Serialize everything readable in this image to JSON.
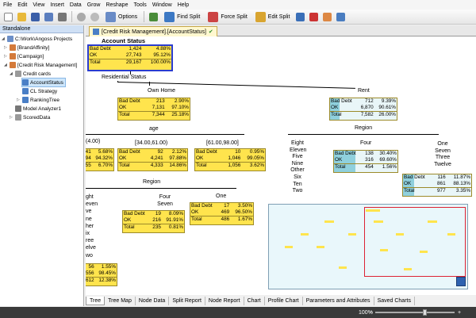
{
  "menu": [
    "File",
    "Edit",
    "View",
    "Insert",
    "Data",
    "Grow",
    "Reshape",
    "Tools",
    "Window",
    "Help"
  ],
  "toolbar": {
    "options": "Options",
    "find_split": "Find Split",
    "force_split": "Force Split",
    "edit_split": "Edit Split"
  },
  "left_panel": {
    "header": "Standalone",
    "items": [
      {
        "label": "C:\\Work\\Angoss Projects",
        "indent": 0
      },
      {
        "label": "[BrandAffinity]",
        "indent": 1
      },
      {
        "label": "[Campaign]",
        "indent": 1
      },
      {
        "label": "[Credit Risk Management]",
        "indent": 1
      },
      {
        "label": "Credit cards",
        "indent": 2
      },
      {
        "label": "AccountStatus",
        "indent": 3
      },
      {
        "label": "CL Strategy",
        "indent": 3
      },
      {
        "label": "RankingTree",
        "indent": 3
      },
      {
        "label": "Model Analyzer1",
        "indent": 2
      },
      {
        "label": "ScoredData",
        "indent": 2
      }
    ]
  },
  "doc_tab": "[Credit Risk Management].[AccountStatus]",
  "tree": {
    "root_title": "Account Status",
    "root": [
      [
        "Bad Debt",
        "1,424",
        "4.88%"
      ],
      [
        "OK",
        "27,743",
        "95.12%"
      ],
      [
        "Total",
        "29,167",
        "100.00%"
      ]
    ],
    "split1": "Residential Status",
    "own_home_label": "Own Home",
    "own_home": [
      [
        "Bad Debt",
        "213",
        "2.90%"
      ],
      [
        "OK",
        "7,131",
        "97.10%"
      ],
      [
        "Total",
        "7,344",
        "25.18%"
      ]
    ],
    "rent_label": "Rent",
    "rent": [
      [
        "Bad Debt",
        "712",
        "9.39%"
      ],
      [
        "OK",
        "6,870",
        "90.61%"
      ],
      [
        "Total",
        "7,582",
        "26.00%"
      ]
    ],
    "age_label": "age",
    "age_left_range": "(4.00)",
    "age_left": [
      [
        "",
        "41",
        "5.68%"
      ],
      [
        "",
        "94",
        "94.32%"
      ],
      [
        "",
        "55",
        "6.70%"
      ]
    ],
    "age_mid_range": "[34.00,61.00)",
    "age_mid": [
      [
        "Bad Debt",
        "92",
        "2.12%"
      ],
      [
        "OK",
        "4,241",
        "97.88%"
      ],
      [
        "Total",
        "4,333",
        "14.86%"
      ]
    ],
    "age_right_range": "[61.00,98.00]",
    "age_right": [
      [
        "Bad Debt",
        "10",
        "0.95%"
      ],
      [
        "OK",
        "1,046",
        "99.05%"
      ],
      [
        "Total",
        "1,056",
        "3.62%"
      ]
    ],
    "region_label": "Region",
    "region_left_list": [
      "Eight",
      "Eleven",
      "Five",
      "Nine",
      "Other",
      "Six",
      "Ten",
      "Two"
    ],
    "four_label": "Four",
    "four": [
      [
        "Bad Debt",
        "138",
        "30.40%"
      ],
      [
        "OK",
        "316",
        "69.60%"
      ],
      [
        "Total",
        "454",
        "1.56%"
      ]
    ],
    "one_label": "One",
    "one_list": [
      "Seven",
      "Three",
      "Twelve"
    ],
    "one": [
      [
        "Bad Debt",
        "116",
        "11.87%"
      ],
      [
        "OK",
        "861",
        "88.13%"
      ],
      [
        "Total",
        "977",
        "3.35%"
      ]
    ],
    "region2_label": "Region",
    "left_list": [
      "ght",
      "even",
      "ve",
      "ne",
      "her",
      "ix",
      "ree",
      "elve",
      "wo"
    ],
    "four_seven_label": "Four",
    "four_seven_sub": "Seven",
    "four_seven": [
      [
        "Bad Debt",
        "19",
        "8.09%"
      ],
      [
        "OK",
        "216",
        "91.91%"
      ],
      [
        "Total",
        "235",
        "0.81%"
      ]
    ],
    "one2_label": "One",
    "one2": [
      [
        "Bad Debt",
        "17",
        "3.50%"
      ],
      [
        "OK",
        "469",
        "96.50%"
      ],
      [
        "Total",
        "486",
        "1.67%"
      ]
    ],
    "bottom_left": [
      [
        "56",
        "1.55%"
      ],
      [
        "556",
        "98.45%"
      ],
      [
        "612",
        "12.38%"
      ]
    ]
  },
  "bottom_tabs": [
    "Tree",
    "Tree Map",
    "Node Data",
    "Split Report",
    "Node Report",
    "Chart",
    "Profile Chart",
    "Parameters and Attributes",
    "Saved Charts"
  ],
  "status": {
    "zoom": "100%"
  },
  "colors": {
    "node_fill": "#ffe44d",
    "node_bar": "#8fd0dd",
    "selection": "#2a3ccf",
    "minimap_frame": "#d23"
  }
}
